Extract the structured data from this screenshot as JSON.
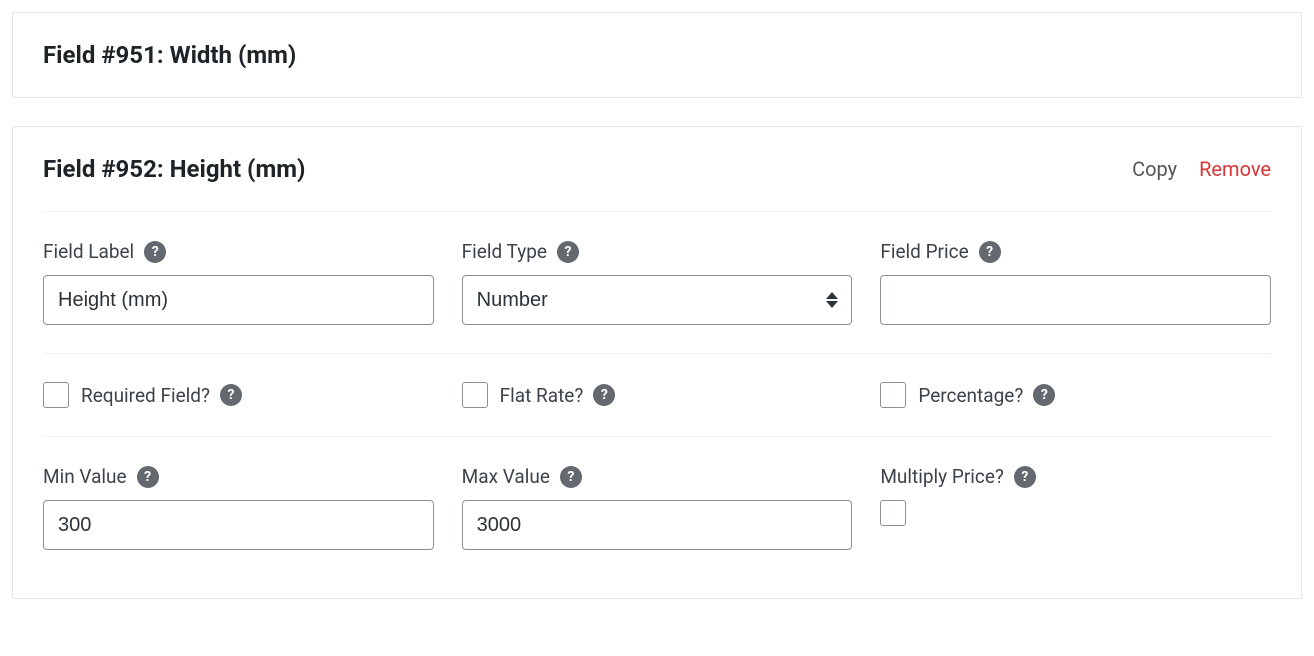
{
  "field951": {
    "title": "Field #951: Width (mm)"
  },
  "field952": {
    "title": "Field #952: Height (mm)",
    "actions": {
      "copy": "Copy",
      "remove": "Remove"
    },
    "labels": {
      "fieldLabel": "Field Label",
      "fieldType": "Field Type",
      "fieldPrice": "Field Price",
      "requiredField": "Required Field?",
      "flatRate": "Flat Rate?",
      "percentage": "Percentage?",
      "minValue": "Min Value",
      "maxValue": "Max Value",
      "multiplyPrice": "Multiply Price?"
    },
    "values": {
      "fieldLabel": "Height (mm)",
      "fieldType": "Number",
      "fieldPrice": "",
      "minValue": "300",
      "maxValue": "3000"
    },
    "helpIcon": "?"
  }
}
